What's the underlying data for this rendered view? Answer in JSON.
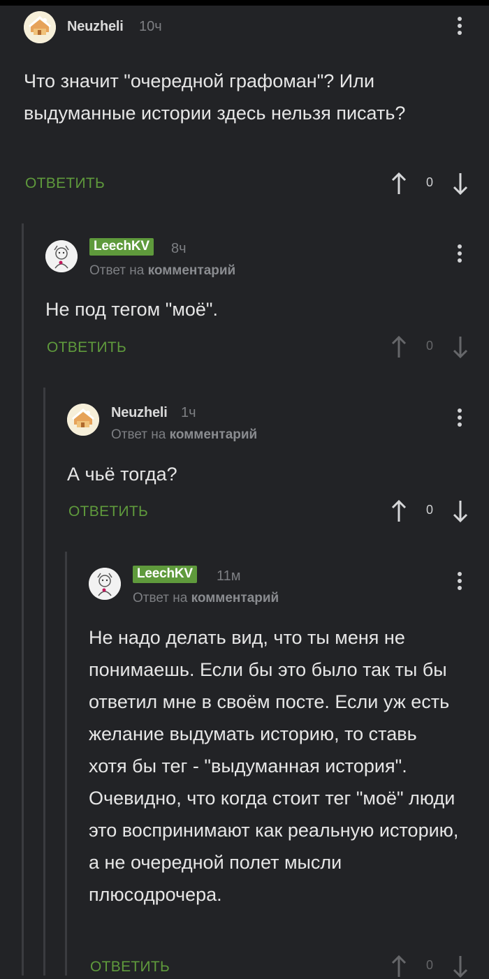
{
  "comments": [
    {
      "author": "Neuzheli",
      "time": "10ч",
      "reply_to_prefix": "",
      "reply_to_link": "",
      "text": "Что значит \"очередной графоман\"? Или выдуманные истории здесь нельзя писать?",
      "reply_label": "ОТВЕТИТЬ",
      "score": "0",
      "avatar_icon": "cake-house-avatar-icon"
    },
    {
      "author": "LeechKV",
      "time": "8ч",
      "reply_to_prefix": "Ответ на",
      "reply_to_link": "комментарий",
      "text": "Не под тегом \"моё\".",
      "reply_label": "ОТВЕТИТЬ",
      "score": "0",
      "avatar_icon": "sketch-character-avatar-icon"
    },
    {
      "author": "Neuzheli",
      "time": "1ч",
      "reply_to_prefix": "Ответ на",
      "reply_to_link": "комментарий",
      "text": "А чьё тогда?",
      "reply_label": "ОТВЕТИТЬ",
      "score": "0",
      "avatar_icon": "cake-house-avatar-icon"
    },
    {
      "author": "LeechKV",
      "time": "11м",
      "reply_to_prefix": "Ответ на",
      "reply_to_link": "комментарий",
      "text": "Не надо делать вид, что ты меня не понимаешь. Если бы это было так ты бы ответил мне в своём посте. Если уж есть желание выдумать историю, то ставь хотя бы тег - \"выдуманная история\". Очевидно, что когда стоит тег \"моё\" люди это воспринимают как реальную историю, а не очередной полет мысли плюсодрочера.",
      "reply_label": "ОТВЕТИТЬ",
      "score": "0",
      "avatar_icon": "sketch-character-avatar-icon"
    }
  ],
  "colors": {
    "background": "#222326",
    "accent_green": "#5f9a3c",
    "muted_text": "#7d7f83",
    "thread_line": "#3b3c40"
  }
}
